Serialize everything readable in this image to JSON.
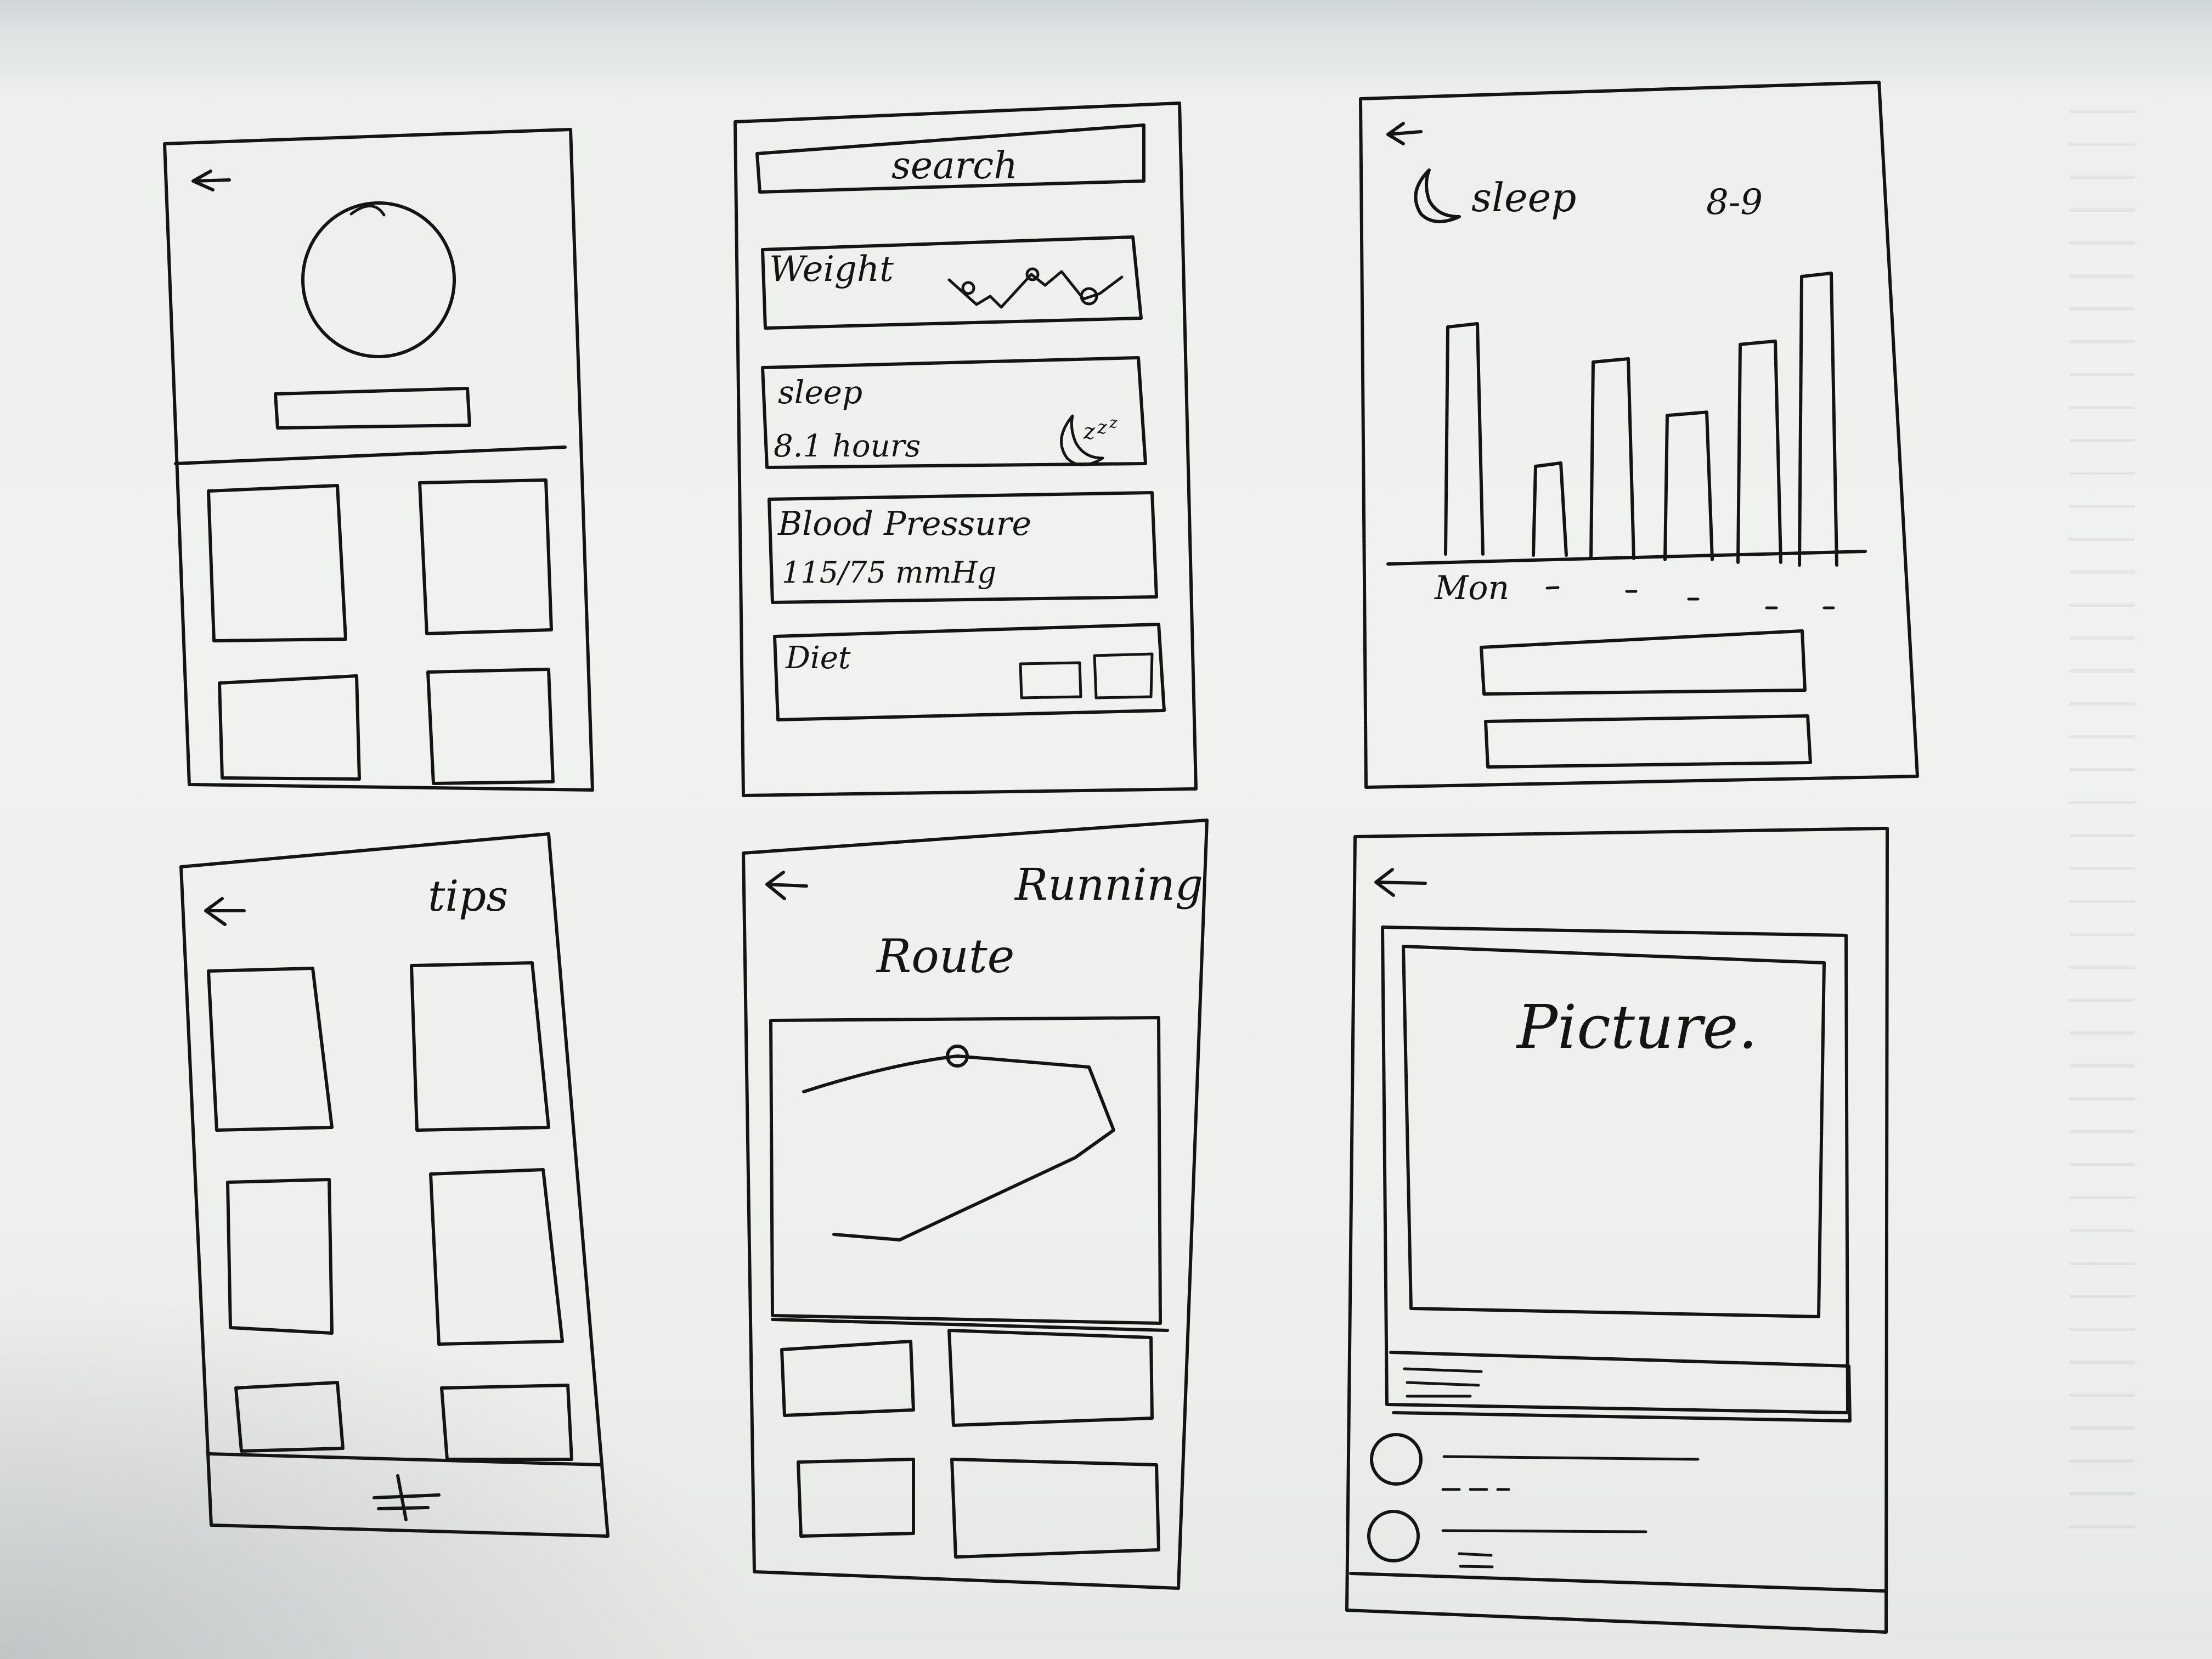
{
  "screens": [
    {
      "id": "profile",
      "back_icon": "arrow-left-icon"
    },
    {
      "id": "dashboard",
      "search_label": "search",
      "cards": [
        {
          "title": "Weight",
          "icon": "line-chart-icon"
        },
        {
          "title": "sleep",
          "value": "8.1 hours",
          "icon": "moon-zzz-icon"
        },
        {
          "title": "Blood Pressure",
          "value": "115/75 mmHg"
        },
        {
          "title": "Diet"
        }
      ]
    },
    {
      "id": "sleep-detail",
      "title": "sleep",
      "range": "8-9",
      "day_label": "Mon",
      "back_icon": "arrow-left-icon",
      "icon": "moon-icon"
    },
    {
      "id": "tips",
      "title": "tips",
      "add_icon": "plus-icon",
      "back_icon": "arrow-left-icon"
    },
    {
      "id": "running",
      "title": "Running",
      "subtitle": "Route",
      "back_icon": "arrow-left-icon"
    },
    {
      "id": "picture",
      "placeholder": "Picture.",
      "back_icon": "arrow-left-icon"
    }
  ],
  "chart_data": {
    "type": "bar",
    "categories": [
      "Mon",
      "",
      "",
      "",
      "",
      "",
      ""
    ],
    "values": [
      0.75,
      0.3,
      0.65,
      0.48,
      0.72,
      0.95,
      0.0
    ],
    "title": "sleep",
    "xlabel": "",
    "ylabel": ""
  }
}
